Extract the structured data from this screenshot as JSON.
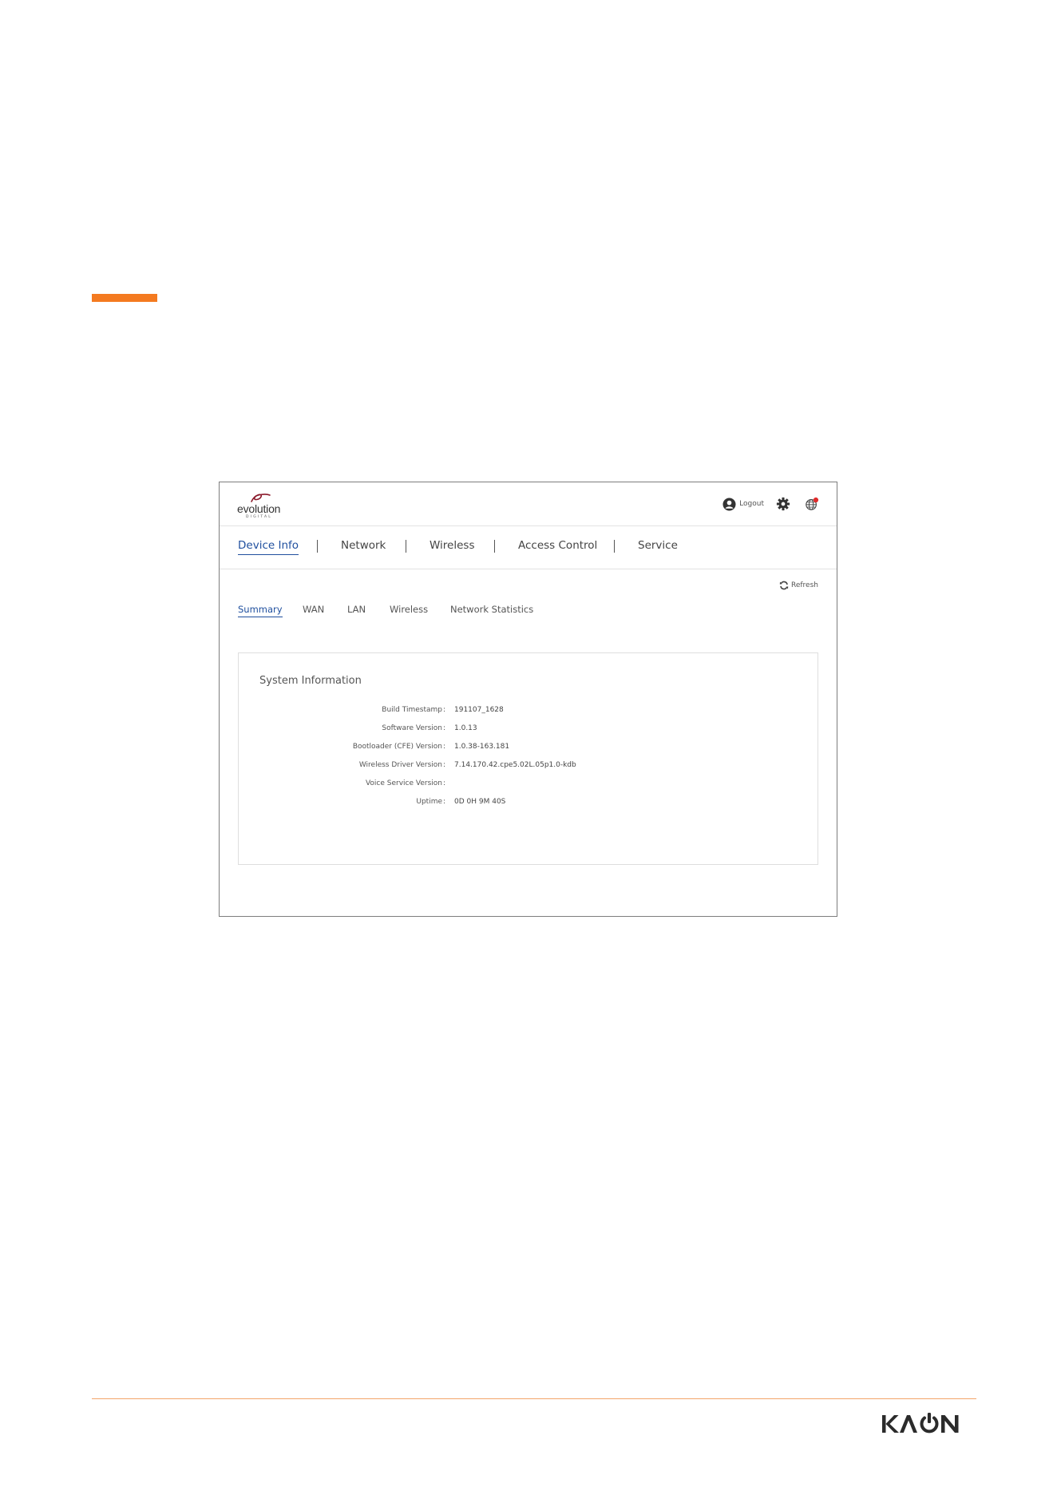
{
  "page": {
    "accent_color": "#f47a20"
  },
  "router_ui": {
    "logo": {
      "wordmark": "evolution",
      "subtext": "DIGITAL"
    },
    "header": {
      "logout_label": "Logout"
    },
    "main_nav": {
      "items": [
        "Device Info",
        "Network",
        "Wireless",
        "Access Control",
        "Service"
      ],
      "active": "Device Info"
    },
    "refresh_label": "Refresh",
    "sub_nav": {
      "items": [
        "Summary",
        "WAN",
        "LAN",
        "Wireless",
        "Network Statistics"
      ],
      "active": "Summary"
    },
    "system_info": {
      "title": "System Information",
      "rows": [
        {
          "label": "Build Timestamp",
          "value": "191107_1628"
        },
        {
          "label": "Software Version",
          "value": "1.0.13"
        },
        {
          "label": "Bootloader (CFE) Version",
          "value": "1.0.38-163.181"
        },
        {
          "label": "Wireless Driver Version",
          "value": "7.14.170.42.cpe5.02L.05p1.0-kdb"
        },
        {
          "label": "Voice Service Version",
          "value": ""
        },
        {
          "label": "Uptime",
          "value": "0D 0H 9M 40S"
        }
      ]
    },
    "colors": {
      "active_link": "#1f4f9e",
      "border": "#7d7d7d"
    }
  },
  "footer": {
    "brand": "KAON",
    "line_color": "#f3a46a"
  }
}
